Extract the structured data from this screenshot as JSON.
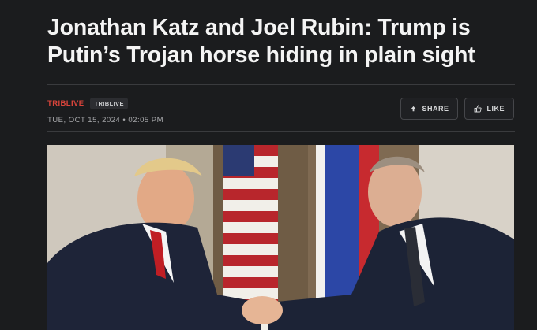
{
  "article": {
    "headline_line1": "Jonathan Katz and Joel Rubin: Trump is",
    "headline_line2": "Putin’s Trojan horse hiding in plain sight",
    "source": "TRIBLIVE",
    "source_tag": "TRIBLIVE",
    "dateline": "TUE, OCT 15, 2024 • 02:05 PM"
  },
  "actions": {
    "share_label": "SHARE",
    "share_icon": "upload-arrow-icon",
    "like_label": "LIKE",
    "like_icon": "thumbs-up-icon"
  },
  "colors": {
    "background": "#1b1c1e",
    "source_accent": "#d9443b"
  }
}
